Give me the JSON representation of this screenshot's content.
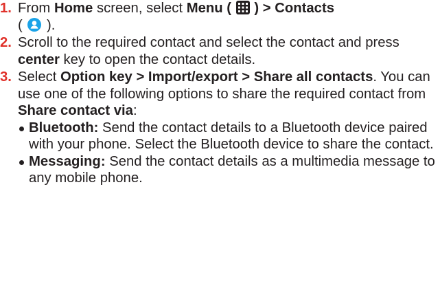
{
  "steps": [
    {
      "number": "1.",
      "t1": "From ",
      "home": "Home",
      "t2": " screen, select ",
      "menu": "Menu (",
      "menu_close": ") > Contacts",
      "paren_open": "(",
      "paren_close": ")."
    },
    {
      "number": "2.",
      "t1": "Scroll to the required contact and select the contact and press ",
      "center": "center",
      "t2": " key to open the contact details."
    },
    {
      "number": "3.",
      "t1": "Select ",
      "option": "Option key > Import/export  > Share all contacts",
      "t2": ". You can use one of the following options to share the required contact from ",
      "share_via": "Share contact via",
      "t3": ":",
      "bullets": [
        {
          "label": "Bluetooth:",
          "text": " Send the contact details to a Bluetooth device paired with your phone. Select the Bluetooth device to share the contact."
        },
        {
          "label": "Messaging:",
          "text": " Send the contact details as a multimedia message to any mobile phone."
        }
      ]
    }
  ],
  "icons": {
    "menu": "grid-menu-icon",
    "contacts": "contacts-person-icon"
  },
  "colors": {
    "step_number": "#e0312a",
    "text": "#231f20",
    "contacts_icon": "#1ba3e8"
  }
}
